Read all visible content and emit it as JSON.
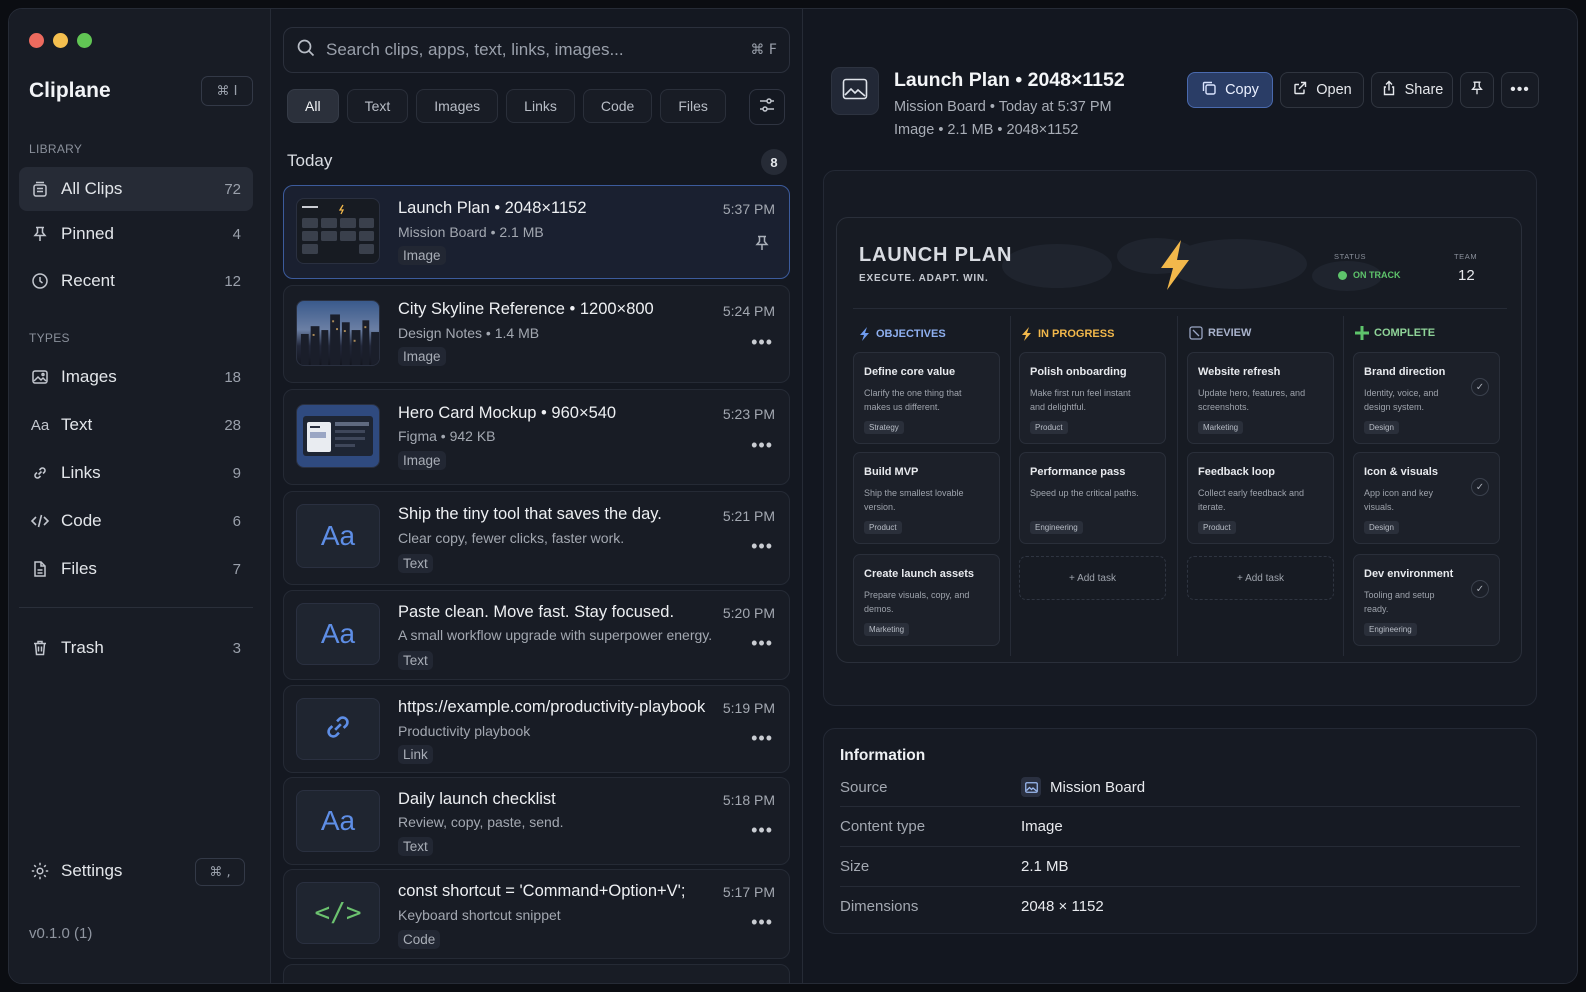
{
  "app": {
    "name": "Cliplane",
    "shortcut": "⌘ I",
    "version": "v0.1.0 (1)"
  },
  "window": {
    "traffic_lights": [
      "#ec6a5e",
      "#f4bf4f",
      "#61c554"
    ]
  },
  "sidebar": {
    "library_label": "LIBRARY",
    "library": [
      {
        "label": "All Clips",
        "count": "72",
        "icon": "stack-icon"
      },
      {
        "label": "Pinned",
        "count": "4",
        "icon": "pin-icon"
      },
      {
        "label": "Recent",
        "count": "12",
        "icon": "clock-icon"
      }
    ],
    "types_label": "TYPES",
    "types": [
      {
        "label": "Images",
        "count": "18",
        "icon": "image-icon"
      },
      {
        "label": "Text",
        "count": "28",
        "icon": "text-icon",
        "glyph": "Aa"
      },
      {
        "label": "Links",
        "count": "9",
        "icon": "link-icon"
      },
      {
        "label": "Code",
        "count": "6",
        "icon": "code-icon"
      },
      {
        "label": "Files",
        "count": "7",
        "icon": "file-icon"
      }
    ],
    "trash": {
      "label": "Trash",
      "count": "3"
    },
    "settings": {
      "label": "Settings",
      "shortcut": "⌘ ,"
    }
  },
  "search": {
    "placeholder": "Search clips, apps, text, links, images...",
    "shortcut": "⌘ F"
  },
  "filters": [
    "All",
    "Text",
    "Images",
    "Links",
    "Code",
    "Files"
  ],
  "list": {
    "group": "Today",
    "group_count": "8",
    "clips": [
      {
        "title": "Launch Plan • 2048×1152",
        "sub": "Mission Board  •  2.1 MB",
        "type": "Image",
        "time": "5:37 PM"
      },
      {
        "title": "City Skyline Reference • 1200×800",
        "sub": "Design Notes  •  1.4 MB",
        "type": "Image",
        "time": "5:24 PM"
      },
      {
        "title": "Hero Card Mockup • 960×540",
        "sub": "Figma  •  942 KB",
        "type": "Image",
        "time": "5:23 PM"
      },
      {
        "title": "Ship the tiny tool that saves the day.",
        "sub": "Clear copy, fewer clicks, faster work.",
        "type": "Text",
        "time": "5:21 PM",
        "glyph": "Aa"
      },
      {
        "title": "Paste clean. Move fast. Stay focused.",
        "sub": "A small workflow upgrade with superpower energy.",
        "type": "Text",
        "time": "5:20 PM",
        "glyph": "Aa"
      },
      {
        "title": "https://example.com/productivity-playbook",
        "sub": "Productivity playbook",
        "type": "Link",
        "time": "5:19 PM"
      },
      {
        "title": "Daily launch checklist",
        "sub": "Review, copy, paste, send.",
        "type": "Text",
        "time": "5:18 PM",
        "glyph": "Aa"
      },
      {
        "title": "const shortcut = 'Command+Option+V';",
        "sub": "Keyboard shortcut snippet",
        "type": "Code",
        "time": "5:17 PM",
        "glyph": "</>"
      }
    ]
  },
  "detail": {
    "title": "Launch Plan • 2048×1152",
    "meta": "Mission Board  •  Today at 5:37 PM",
    "meta2": "Image  •  2.1 MB  •  2048×1152",
    "actions": {
      "copy": "Copy",
      "open": "Open",
      "share": "Share"
    },
    "accent": "#4a6aae"
  },
  "board": {
    "title": "LAUNCH PLAN",
    "subtitle": "EXECUTE. ADAPT. WIN.",
    "status_label": "STATUS",
    "status_value": "ON TRACK",
    "team_label": "TEAM",
    "team_value": "12",
    "columns": [
      {
        "name": "OBJECTIVES",
        "color": "#6f9cf0",
        "cards": [
          {
            "title": "Define core value",
            "desc": "Clarify the one thing that makes us different.",
            "tag": "Strategy"
          },
          {
            "title": "Build MVP",
            "desc": "Ship the smallest lovable version.",
            "tag": "Product"
          },
          {
            "title": "Create launch assets",
            "desc": "Prepare visuals, copy, and demos.",
            "tag": "Marketing"
          }
        ]
      },
      {
        "name": "IN PROGRESS",
        "color": "#f2b84b",
        "cards": [
          {
            "title": "Polish onboarding",
            "desc": "Make first run feel instant and delightful.",
            "tag": "Product"
          },
          {
            "title": "Performance pass",
            "desc": "Speed up the critical paths.",
            "tag": "Engineering"
          }
        ],
        "add": "+ Add task"
      },
      {
        "name": "REVIEW",
        "color": "#9aa6c4",
        "cards": [
          {
            "title": "Website refresh",
            "desc": "Update hero, features, and screenshots.",
            "tag": "Marketing"
          },
          {
            "title": "Feedback loop",
            "desc": "Collect early feedback and iterate.",
            "tag": "Product"
          }
        ],
        "add": "+ Add task"
      },
      {
        "name": "COMPLETE",
        "color": "#5ec46b",
        "cards": [
          {
            "title": "Brand direction",
            "desc": "Identity, voice, and design system.",
            "tag": "Design"
          },
          {
            "title": "Icon & visuals",
            "desc": "App icon and key visuals.",
            "tag": "Design"
          },
          {
            "title": "Dev environment",
            "desc": "Tooling and setup ready.",
            "tag": "Engineering"
          }
        ]
      }
    ]
  },
  "info": {
    "heading": "Information",
    "rows": [
      {
        "key": "Source",
        "value": "Mission Board"
      },
      {
        "key": "Content type",
        "value": "Image"
      },
      {
        "key": "Size",
        "value": "2.1 MB"
      },
      {
        "key": "Dimensions",
        "value": "2048 × 1152"
      }
    ]
  }
}
